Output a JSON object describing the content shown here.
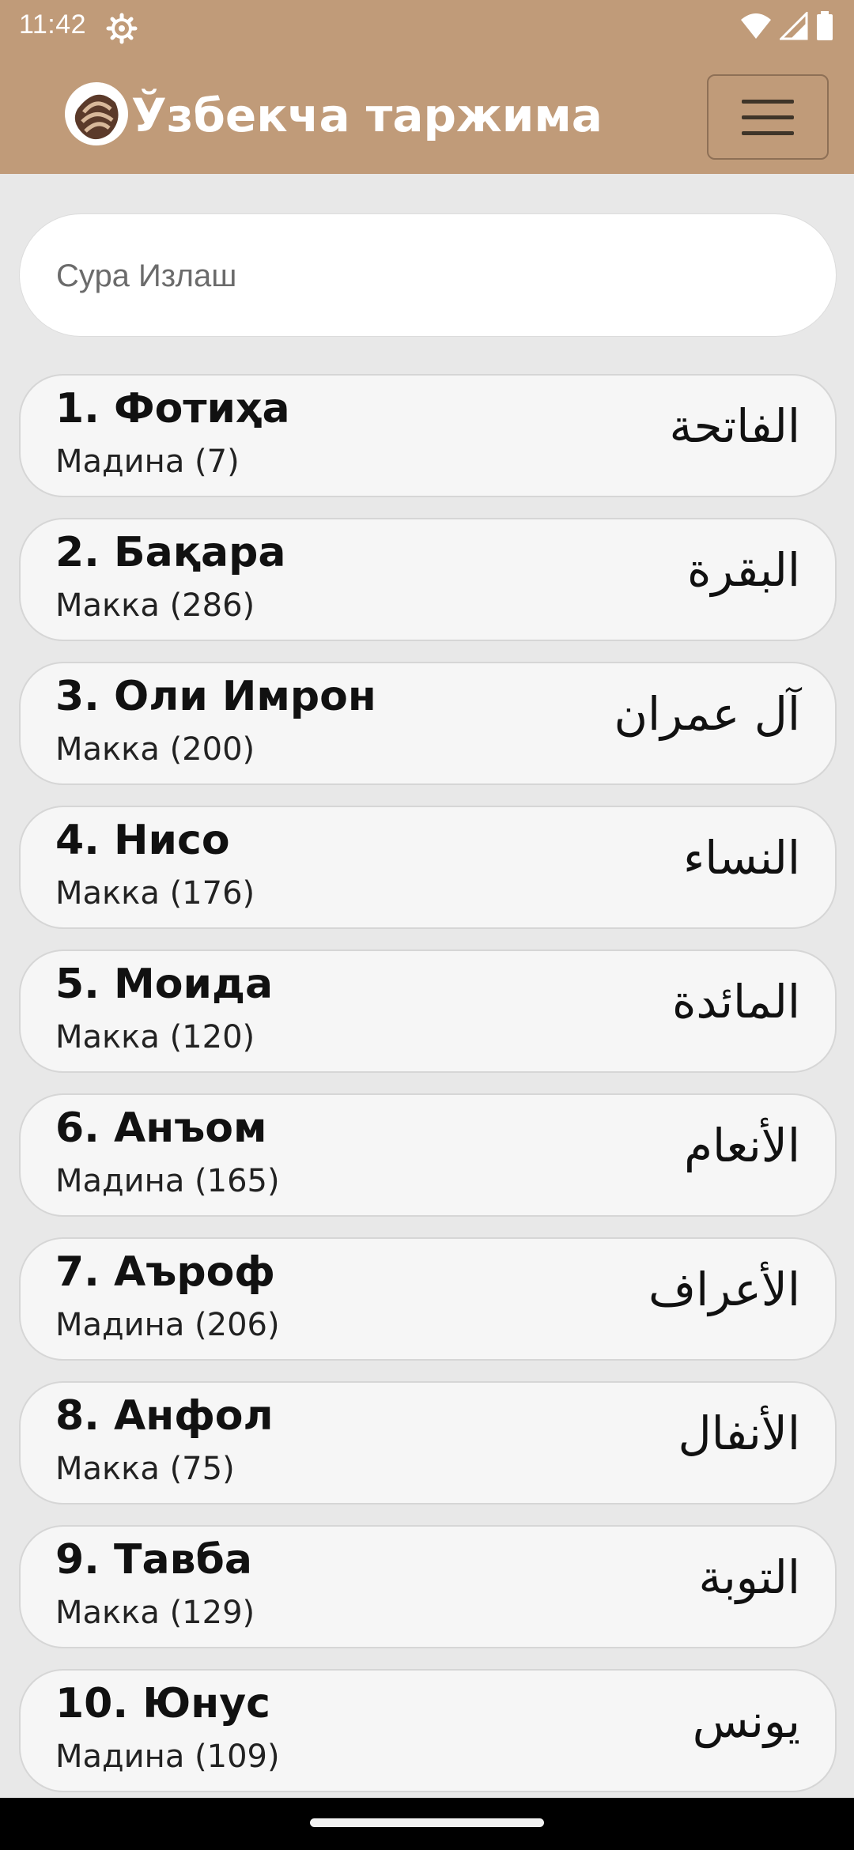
{
  "status_bar": {
    "time": "11:42",
    "icons": [
      "gear-icon",
      "wifi-icon",
      "signal-icon",
      "battery-icon"
    ]
  },
  "app_bar": {
    "title": "Ўзбекча таржима",
    "logo": "app-logo",
    "menu_icon": "hamburger-menu-icon",
    "background": "#c09b79"
  },
  "search": {
    "placeholder": "Сура Излаш",
    "value": ""
  },
  "surahs": [
    {
      "title": "1. Фотиҳа",
      "subtitle": "Мадина (7)",
      "arabic": "الفاتحة"
    },
    {
      "title": "2. Бақара",
      "subtitle": "Макка (286)",
      "arabic": "البقرة"
    },
    {
      "title": "3. Оли Имрон",
      "subtitle": "Макка (200)",
      "arabic": "آل عمران"
    },
    {
      "title": "4. Нисо",
      "subtitle": "Макка (176)",
      "arabic": "النساء"
    },
    {
      "title": "5. Моида",
      "subtitle": "Макка (120)",
      "arabic": "المائدة"
    },
    {
      "title": "6. Анъом",
      "subtitle": "Мадина (165)",
      "arabic": "الأنعام"
    },
    {
      "title": "7. Аъроф",
      "subtitle": "Мадина (206)",
      "arabic": "الأعراف"
    },
    {
      "title": "8. Анфол",
      "subtitle": "Макка (75)",
      "arabic": "الأنفال"
    },
    {
      "title": "9. Тавба",
      "subtitle": "Макка (129)",
      "arabic": "التوبة"
    },
    {
      "title": "10. Юнус",
      "subtitle": "Мадина (109)",
      "arabic": "يونس"
    }
  ]
}
